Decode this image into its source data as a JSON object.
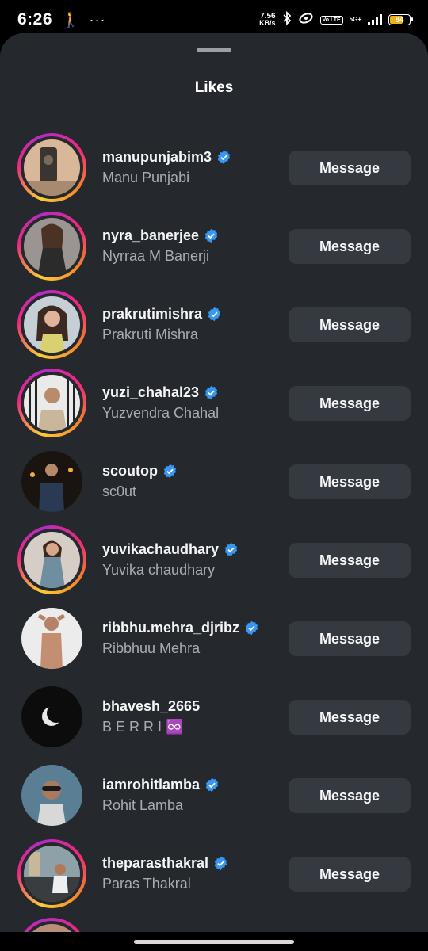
{
  "status_bar": {
    "time": "6:26",
    "speed_value": "7.56",
    "speed_unit": "KB/s",
    "network": "5G+",
    "vo_label": "Vo LTE",
    "battery_level": "84"
  },
  "sheet": {
    "title": "Likes"
  },
  "likes": [
    {
      "username": "manupunjabim3",
      "name": "Manu Punjabi",
      "verified": true,
      "button": "Message"
    },
    {
      "username": "nyra_banerjee",
      "name": "Nyrraa M Banerji",
      "verified": true,
      "button": "Message"
    },
    {
      "username": "prakrutimishra",
      "name": "Prakruti Mishra",
      "verified": true,
      "button": "Message"
    },
    {
      "username": "yuzi_chahal23",
      "name": "Yuzvendra Chahal",
      "verified": true,
      "button": "Message"
    },
    {
      "username": "scoutop",
      "name": "sc0ut",
      "verified": true,
      "button": "Message"
    },
    {
      "username": "yuvikachaudhary",
      "name": "Yuvika chaudhary",
      "verified": true,
      "button": "Message"
    },
    {
      "username": "ribbhu.mehra_djribz",
      "name": "Ribbhuu Mehra",
      "verified": true,
      "button": "Message"
    },
    {
      "username": "bhavesh_2665",
      "name": "B E R R I ♾️",
      "verified": false,
      "button": "Message"
    },
    {
      "username": "iamrohitlamba",
      "name": "Rohit Lamba",
      "verified": true,
      "button": "Message"
    },
    {
      "username": "theparasthakral",
      "name": "Paras Thakral",
      "verified": true,
      "button": "Message"
    }
  ]
}
